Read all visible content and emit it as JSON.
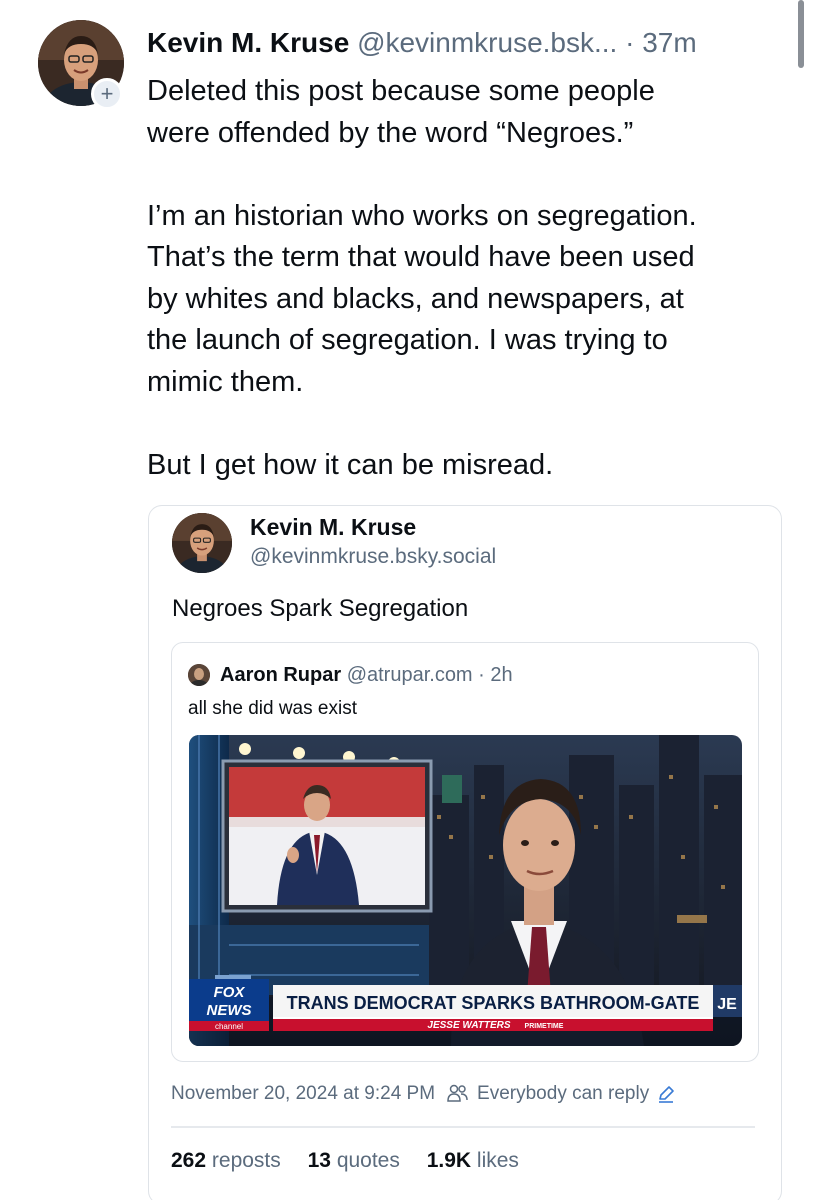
{
  "post": {
    "author_name": "Kevin M. Kruse",
    "author_handle": "@kevinmkruse.bsk...",
    "separator": "·",
    "time_ago": "37m",
    "follow_symbol": "+",
    "body": {
      "p1_line1": "Deleted this post because some people",
      "p1_line2": "were offended by the word “Negroes.”",
      "p2_line1": "I’m an historian who works on segregation.",
      "p2_line2": "That’s the term that would have been used",
      "p2_line3": "by whites and blacks, and newspapers, at",
      "p2_line4": "the launch of segregation. I was trying to",
      "p2_line5": "mimic them.",
      "p3_line1": "But I get how it can be misread."
    }
  },
  "quoted_post": {
    "author_name": "Kevin M. Kruse",
    "author_handle": "@kevinmkruse.bsky.social",
    "text": "Negroes Spark Segregation",
    "nested_quote": {
      "author_name": "Aaron Rupar",
      "author_handle": "@atrupar.com",
      "separator": "·",
      "time_ago": "2h",
      "text": "all she did was exist",
      "media": {
        "logo_line1": "FOX",
        "logo_line2": "NEWS",
        "logo_line3": "channel",
        "headline": "TRANS DEMOCRAT SPARKS BATHROOM-GATE",
        "show_name": "JESSE WATTERS",
        "show_tag": "PRIMETIME",
        "corner_text": "JE"
      }
    },
    "timestamp": "November 20, 2024 at 9:24 PM",
    "reply_setting": "Everybody can reply",
    "stats": {
      "reposts_count": "262",
      "reposts_label": "reposts",
      "quotes_count": "13",
      "quotes_label": "quotes",
      "likes_count": "1.9K",
      "likes_label": "likes"
    }
  },
  "colors": {
    "text_primary": "#0b0f14",
    "text_secondary": "#5b6b7d",
    "border": "#dfe3e8",
    "fox_blue": "#0b3c8c",
    "fox_red": "#c8102e"
  },
  "icons": {
    "people": "people-icon",
    "edit": "pencil-icon"
  }
}
